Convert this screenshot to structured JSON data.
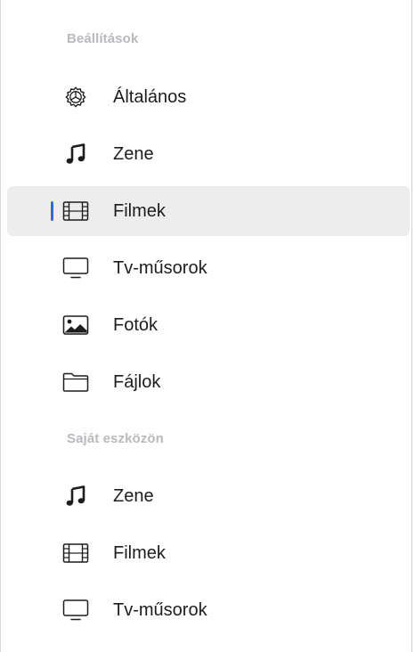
{
  "sidebar": {
    "settings_header": "Beállítások",
    "settings_items": [
      {
        "label": "Általános",
        "icon": "gear-icon"
      },
      {
        "label": "Zene",
        "icon": "music-note-icon"
      },
      {
        "label": "Filmek",
        "icon": "film-icon",
        "selected": true
      },
      {
        "label": "Tv-műsorok",
        "icon": "tv-icon"
      },
      {
        "label": "Fotók",
        "icon": "photo-icon"
      },
      {
        "label": "Fájlok",
        "icon": "folder-icon"
      }
    ],
    "device_header": "Saját eszközön",
    "device_items": [
      {
        "label": "Zene",
        "icon": "music-note-icon"
      },
      {
        "label": "Filmek",
        "icon": "film-icon"
      },
      {
        "label": "Tv-műsorok",
        "icon": "tv-icon"
      }
    ]
  },
  "colors": {
    "accent": "#1f6fff",
    "selected_background": "#ededed",
    "section_header": "#b9b9be"
  }
}
